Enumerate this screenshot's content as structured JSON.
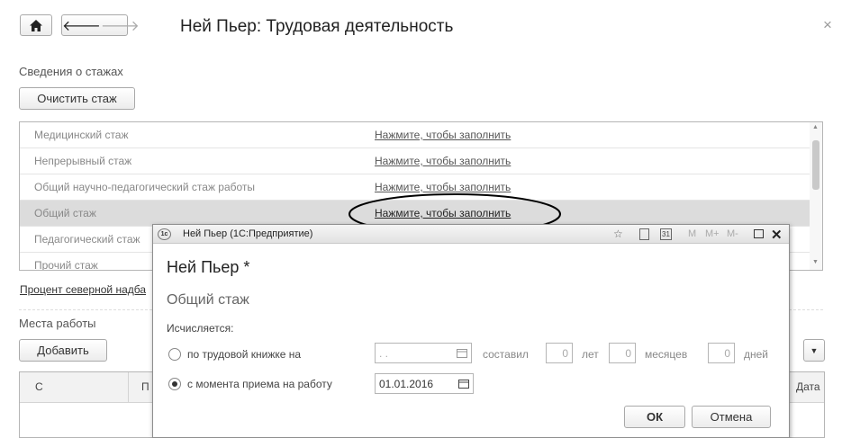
{
  "window": {
    "title": "Ней Пьер: Трудовая деятельность",
    "close": "×"
  },
  "stazh": {
    "section_label": "Сведения о стажах",
    "clear_button": "Очистить стаж",
    "rows": [
      {
        "name": "Медицинский стаж",
        "value": "Нажмите, чтобы заполнить"
      },
      {
        "name": "Непрерывный стаж",
        "value": "Нажмите, чтобы заполнить"
      },
      {
        "name": "Общий научно-педагогический стаж работы",
        "value": "Нажмите, чтобы заполнить"
      },
      {
        "name": "Общий стаж",
        "value": "Нажмите, чтобы заполнить"
      },
      {
        "name": "Педагогический стаж",
        "value": ""
      },
      {
        "name": "Прочий стаж",
        "value": ""
      }
    ]
  },
  "north_link": "Процент северной надба",
  "places": {
    "section_label": "Места работы",
    "add_button": "Добавить",
    "col_from": "С",
    "col_p": "П",
    "col_date": "Дата"
  },
  "dialog": {
    "window_title": "Ней Пьер  (1С:Предприятие)",
    "icon_label": "1c",
    "heading": "Ней Пьер *",
    "subheading": "Общий стаж",
    "calc_label": "Исчисляется:",
    "option1_label": "по трудовой книжке на",
    "option1_date_placeholder": " .  .",
    "sostavil": "составил",
    "years_value": "0",
    "years_label": "лет",
    "months_value": "0",
    "months_label": "месяцев",
    "days_value": "0",
    "days_label": "дней",
    "option2_label": "с момента приема на работу",
    "option2_date": "01.01.2016",
    "ok_button": "ОК",
    "cancel_button": "Отмена",
    "toolbar_m": "M",
    "toolbar_mplus": "M+",
    "toolbar_mminus": "M-",
    "cal_day": "31"
  }
}
